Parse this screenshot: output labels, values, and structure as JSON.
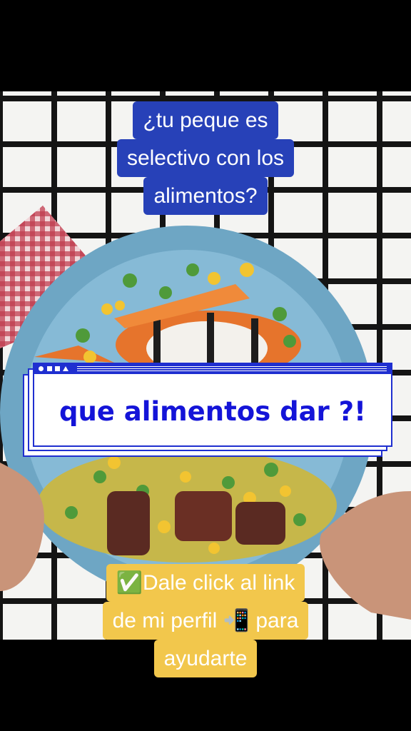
{
  "captions": {
    "top": [
      "¿tu peque es",
      "selectivo con los",
      "alimentos?"
    ],
    "banner": "que alimentos dar ?!",
    "bottom": [
      "✅Dale click al link",
      "de mi perfil 📲 para",
      "ayudarte"
    ]
  },
  "colors": {
    "top_caption_bg": "#2741b8",
    "bottom_caption_bg": "#f2c74c",
    "banner_text": "#1414d8",
    "banner_border": "#1f2fd0",
    "plate": "#7fb3d0"
  },
  "icons": [
    "check-mark-emoji",
    "phone-arrow-emoji"
  ]
}
